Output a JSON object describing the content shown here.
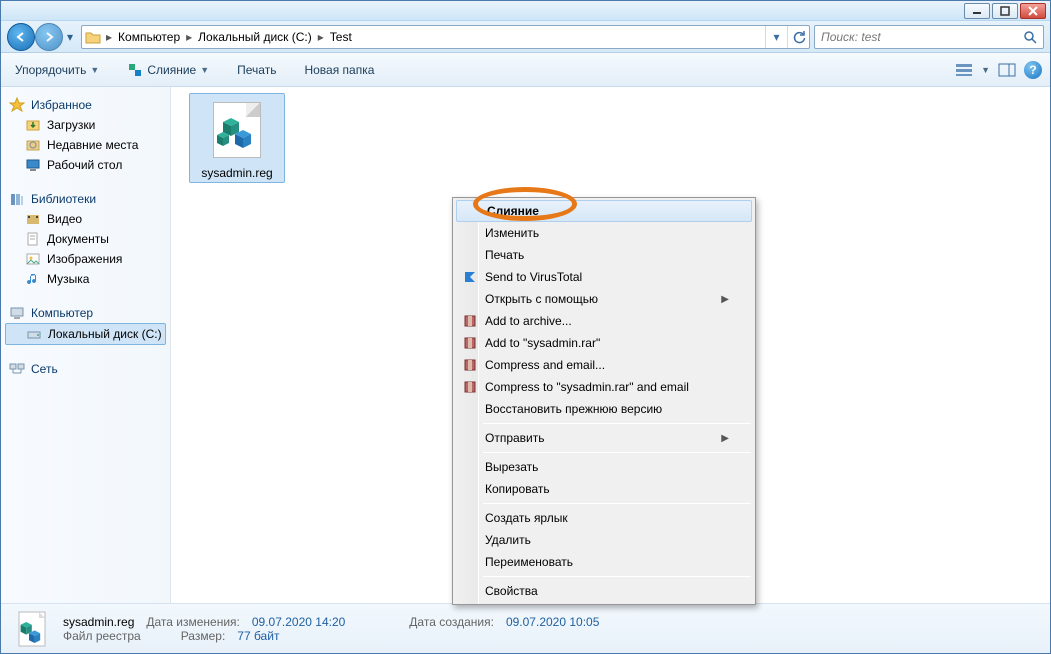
{
  "breadcrumb": {
    "c0": "Компьютер",
    "c1": "Локальный диск (C:)",
    "c2": "Test"
  },
  "search": {
    "placeholder": "Поиск: test"
  },
  "toolbar": {
    "organize": "Упорядочить",
    "merge": "Слияние",
    "print": "Печать",
    "newfolder": "Новая папка"
  },
  "sidebar": {
    "fav_head": "Избранное",
    "fav": {
      "downloads": "Загрузки",
      "recent": "Недавние места",
      "desktop": "Рабочий стол"
    },
    "lib_head": "Библиотеки",
    "lib": {
      "video": "Видео",
      "docs": "Документы",
      "images": "Изображения",
      "music": "Музыка"
    },
    "comp_head": "Компьютер",
    "comp": {
      "disk": "Локальный диск (C:)"
    },
    "net_head": "Сеть"
  },
  "file": {
    "name": "sysadmin.reg"
  },
  "ctx": {
    "merge": "Слияние",
    "edit": "Изменить",
    "print": "Печать",
    "virustotal": "Send to VirusTotal",
    "openwith": "Открыть с помощью",
    "addarchive": "Add to archive...",
    "addrar": "Add to \"sysadmin.rar\"",
    "compressemail": "Compress and email...",
    "compressraremail": "Compress to \"sysadmin.rar\" and email",
    "restore": "Восстановить прежнюю версию",
    "sendto": "Отправить",
    "cut": "Вырезать",
    "copy": "Копировать",
    "shortcut": "Создать ярлык",
    "delete": "Удалить",
    "rename": "Переименовать",
    "properties": "Свойства"
  },
  "details": {
    "filename": "sysadmin.reg",
    "filetype": "Файл реестра",
    "mod_label": "Дата изменения:",
    "mod_val": "09.07.2020 14:20",
    "size_label": "Размер:",
    "size_val": "77 байт",
    "created_label": "Дата создания:",
    "created_val": "09.07.2020 10:05"
  }
}
